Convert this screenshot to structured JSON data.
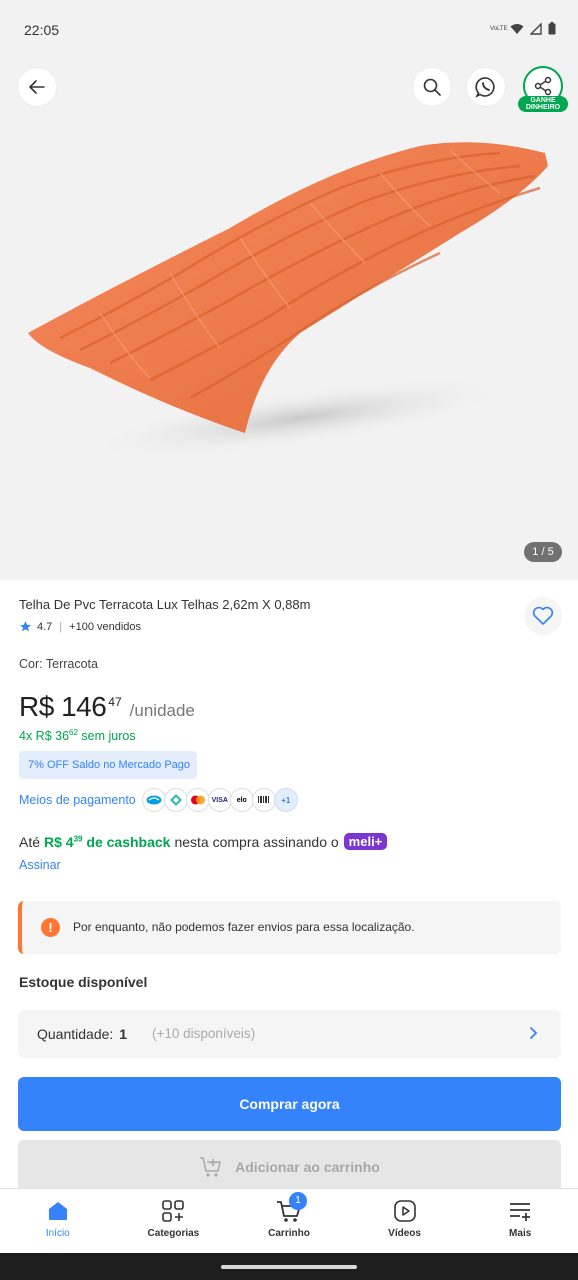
{
  "status_bar": {
    "time": "22:05",
    "network_label": "VoLTE"
  },
  "header": {
    "share_badge": "GANHE DINHEIRO",
    "image_counter": "1 / 5"
  },
  "product": {
    "title": "Telha De Pvc Terracota Lux Telhas 2,62m X 0,88m",
    "rating": "4.7",
    "sold": "+100 vendidos",
    "color_label": "Cor: Terracota",
    "price_main": "R$ 146",
    "price_cents": "47",
    "price_unit": "/unidade",
    "installments_prefix": "4x R$ 36",
    "installments_cents": "62",
    "installments_suffix": "sem juros",
    "discount": "7% OFF Saldo no Mercado Pago"
  },
  "payment": {
    "label": "Meios de pagamento",
    "icons": [
      "mercado-pago-icon",
      "pix-icon",
      "mastercard-icon",
      "visa-icon",
      "elo-icon",
      "boleto-icon"
    ],
    "more": "+1"
  },
  "cashback": {
    "prefix": "Até",
    "amount_main": "R$ 4",
    "amount_cents": "39",
    "highlight": "de cashback",
    "suffix": "nesta compra assinando o",
    "badge": "meli+",
    "subscribe_link": "Assinar"
  },
  "alert": {
    "text": "Por enquanto, não podemos fazer envios para essa localização."
  },
  "stock": {
    "title": "Estoque disponível",
    "quantity_label": "Quantidade:",
    "quantity_value": "1",
    "available": "(+10 disponíveis)"
  },
  "actions": {
    "buy_now": "Comprar agora",
    "add_to_cart": "Adicionar ao carrinho"
  },
  "bottom_nav": {
    "home": "Início",
    "categories": "Categorias",
    "cart": "Carrinho",
    "cart_count": "1",
    "videos": "Vídeos",
    "more": "Mais"
  },
  "colors": {
    "accent_blue": "#3483fa",
    "success_green": "#00a650",
    "warning_orange": "#ff7733",
    "meli_purple": "#7b35d1",
    "product_terracotta": "#ef7a4c"
  }
}
